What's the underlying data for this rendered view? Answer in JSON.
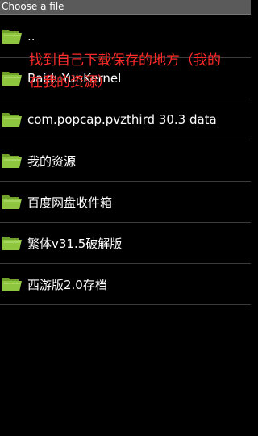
{
  "window": {
    "title": "Choose a file"
  },
  "colors": {
    "background": "#000000",
    "title_bar": "#5a5a5a",
    "divider": "#3a3a3a",
    "folder_icon": "#8ec63f",
    "annotation": "#ff2b2b"
  },
  "file_list": {
    "items": [
      {
        "label": "..",
        "icon": "folder-icon"
      },
      {
        "label": "BaiduYunKernel",
        "icon": "folder-icon"
      },
      {
        "label": "com.popcap.pvzthird 30.3 data",
        "icon": "folder-icon"
      },
      {
        "label": "我的资源",
        "icon": "folder-icon"
      },
      {
        "label": "百度网盘收件箱",
        "icon": "folder-icon"
      },
      {
        "label": "繁体v31.5破解版",
        "icon": "folder-icon"
      },
      {
        "label": "西游版2.0存档",
        "icon": "folder-icon"
      }
    ]
  },
  "annotation": {
    "text": "找到自己下载保存的地方（我的在我的资源）"
  }
}
